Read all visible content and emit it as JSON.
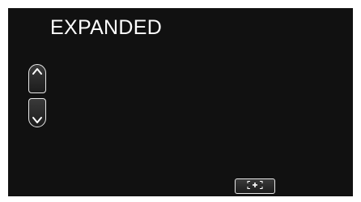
{
  "mode": {
    "title": "EXPANDED"
  },
  "controls": {
    "zoom_in_icon": "chevron-up-icon",
    "zoom_out_icon": "chevron-down-icon",
    "focus_icon": "focus-frame-plus-icon"
  },
  "colors": {
    "background": "#111111",
    "foreground": "#ffffff",
    "button_border": "#e8e8e8"
  }
}
